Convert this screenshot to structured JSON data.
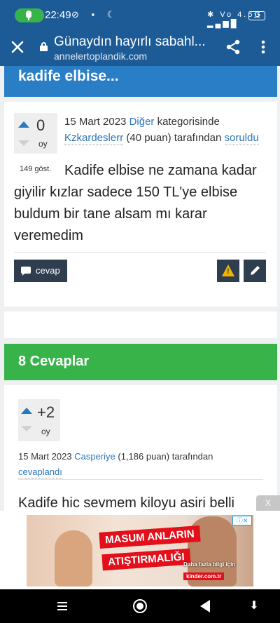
{
  "status_bar": {
    "time": "22:49",
    "left_icons": "⊘ ▪ ☾",
    "right_icons": "✱ Vo 4.5G ▂▄▆█",
    "battery": "11"
  },
  "app_bar": {
    "title": "Günaydın hayırlı sabahl...",
    "url": "annelertoplandik.com",
    "colors": {
      "bar": "#1d5b97"
    }
  },
  "question": {
    "heading": "kadife elbise...",
    "votes": "0",
    "votes_unit": "oy",
    "date": "15 Mart 2023",
    "category": "Diğer",
    "category_suffix": "kategorisinde",
    "author": "Kzkardeslerr",
    "author_points": "(40 puan)",
    "by_text": "tarafından",
    "action": "soruldu",
    "views": "149 göst.",
    "text": "Kadife elbise ne zamana kadar giyilir kızlar sadece 150 TL'ye elbise buldum bir tane alsam mı karar veremedim",
    "answer_button": "cevap"
  },
  "answers": {
    "header": "8 Cevaplar",
    "items": [
      {
        "votes": "+2",
        "votes_unit": "oy",
        "date": "15 Mart 2023",
        "author": "Casperiye",
        "author_points": "(1,186 puan)",
        "by_text": "tarafından",
        "action": "cevaplandı",
        "text": "Kadife hic sevmem kiloyu asiri belli"
      }
    ]
  },
  "ad": {
    "close_label": "X",
    "headline_1": "MASUM ANLARIN",
    "headline_2": "ATIŞTIRMALIĞI",
    "tagline": "Daha fazla bilgi için",
    "url": "kinder.com.tr",
    "adchoice": "ⓘ✕"
  },
  "theme": {
    "accent_blue": "#2a7ec6",
    "answers_green": "#37b34a",
    "dark_button": "#2f3e4f",
    "link": "#2b77bd"
  }
}
